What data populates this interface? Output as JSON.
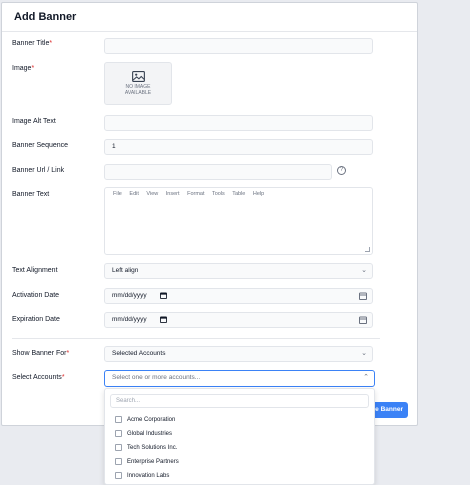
{
  "modal": {
    "title": "Add Banner"
  },
  "form": {
    "banner_title": {
      "label": "Banner Title",
      "required_mark": "*",
      "value": ""
    },
    "image": {
      "label": "Image",
      "required_mark": "*",
      "placeholder_line1": "NO IMAGE",
      "placeholder_line2": "AVAILABLE"
    },
    "image_alt_text": {
      "label": "Image Alt Text",
      "value": ""
    },
    "banner_sequence": {
      "label": "Banner Sequence",
      "value": "1"
    },
    "banner_url": {
      "label": "Banner Url / Link",
      "value": "",
      "help_icon": "?"
    },
    "banner_text": {
      "label": "Banner Text",
      "toolbar": [
        "File",
        "Edit",
        "View",
        "Insert",
        "Format",
        "Tools",
        "Table",
        "Help"
      ]
    },
    "text_alignment": {
      "label": "Text Alignment",
      "value": "Left align"
    },
    "activation_date": {
      "label": "Activation Date",
      "value": "mm/dd/yyyy"
    },
    "expiration_date": {
      "label": "Expiration Date",
      "value": "mm/dd/yyyy"
    },
    "show_banner_for": {
      "label": "Show Banner For",
      "required_mark": "*",
      "value": "Selected Accounts"
    },
    "select_accounts": {
      "label": "Select Accounts",
      "required_mark": "*",
      "placeholder": "Select one or more accounts..."
    }
  },
  "dropdown": {
    "search_placeholder": "Search...",
    "options": [
      "Acme Corporation",
      "Global Industries",
      "Tech Solutions Inc.",
      "Enterprise Partners",
      "Innovation Labs"
    ]
  },
  "save_button": {
    "label": "e Banner"
  },
  "colors": {
    "primary": "#3b82f6",
    "required": "#dc2626"
  },
  "icons": {
    "chevron": "chevron-down-icon",
    "calendar": "calendar-icon",
    "help": "help-icon",
    "image_placeholder": "image-icon"
  }
}
